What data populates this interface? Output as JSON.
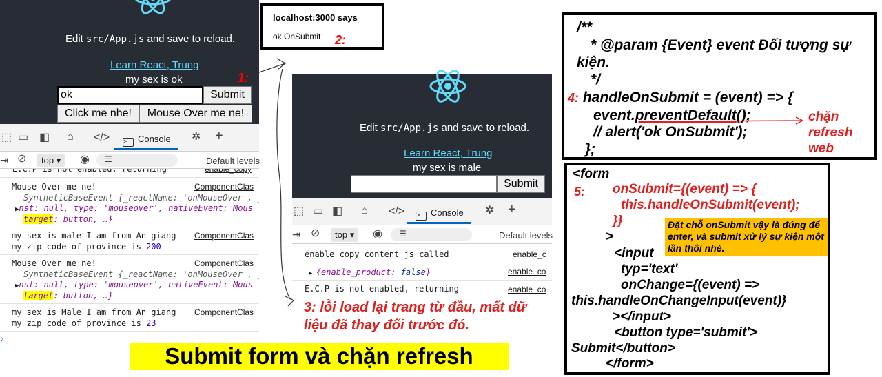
{
  "left_app": {
    "edit_prefix": "Edit ",
    "edit_code": "src/App.js",
    "edit_suffix": " and save to reload.",
    "learn_link": "Learn React, Trung",
    "sex_text": "my sex is ok",
    "input_value": "ok",
    "submit_label": "Submit",
    "click_btn": "Click me nhe!",
    "hover_btn": "Mouse Over me ne!"
  },
  "left_devtools": {
    "console_tab": "Console",
    "context": "top",
    "levels": "Default levels",
    "logs": [
      {
        "text": "E.C.P is not enabled, returning",
        "src": "enable_copy"
      },
      {
        "text": "Mouse Over me ne!",
        "src": "ComponentClas"
      },
      {
        "obj1": "SyntheticBaseEvent {_reactName: 'onMouseOver', _",
        "obj2": "nst: null, type: 'mouseover', nativeEvent: Mous",
        "obj3_hl": "target",
        "obj3_rest": ": button, …}"
      },
      {
        "text": "my sex is  male I am from  An giang",
        "src": "ComponentClas"
      },
      {
        "text_prefix": "my zip code of province is ",
        "num": "200"
      },
      {
        "text": "Mouse Over me ne!",
        "src": "ComponentClas"
      },
      {
        "obj1": "SyntheticBaseEvent {_reactName: 'onMouseOver', _",
        "obj2": "nst: null, type: 'mouseover', nativeEvent: Mous",
        "obj3_hl": "target",
        "obj3_rest": ": button, …}"
      },
      {
        "text": "my sex is  Male I am from  An giang",
        "src": "ComponentClas"
      },
      {
        "text_prefix": "my zip code of province is ",
        "num": "23"
      }
    ]
  },
  "alert": {
    "title": "localhost:3000 says",
    "message": "ok OnSubmit"
  },
  "right_app": {
    "edit_prefix": "Edit ",
    "edit_code": "src/App.js",
    "edit_suffix": " and save to reload.",
    "learn_link": "Learn React, Trung",
    "sex_text": "my sex is male",
    "submit_label": "Submit"
  },
  "right_devtools": {
    "console_tab": "Console",
    "context": "top",
    "levels": "Default levels",
    "log1": "enable copy content js called",
    "log1_src": "enable_c",
    "log2_key": "enable_product",
    "log2_val": "false",
    "log2_src": "enable_co",
    "log3": "E.C.P is not enabled, returning",
    "log3_src": "enable_co"
  },
  "annotations": {
    "n1": "1:",
    "n2": "2:",
    "n3": "3: lỗi load lại trang từ đầu, mất dữ liệu đã thay đổi trước đó.",
    "n4": "4:",
    "n5": "5:",
    "chan_refresh": "chặn refresh web"
  },
  "code_box_1": {
    "l1": "/**",
    "l2": "* @param {Event} event Đối tượng sự",
    "l3": "kiện.",
    "l4": "*/",
    "l5": "handleOnSubmit = (event) => {",
    "l6_a": "event.",
    "l6_b": "preventDefault",
    "l6_c": "();",
    "l7": "// alert('ok OnSubmit');",
    "l8": "};"
  },
  "code_box_2": {
    "l1": "<form",
    "l2": "onSubmit={(event) => {",
    "l3": "this.handleOnSubmit(event);",
    "l4": "}}",
    "l5": ">",
    "l6": "<input",
    "l7": "typ='text'",
    "l8": "onChange={(event) =>",
    "l9": "this.handleOnChangeInput(event)}",
    "l10": "></input>",
    "l11": "<button type='submit'>",
    "l12": "Submit</button>",
    "l13": "</form>",
    "note": "Đặt chỗ onSubmit vậy là đúng để enter, và submit xử lý sự kiện một lần thôi nhé."
  },
  "banner": "Submit form và chặn refresh",
  "colors": {
    "react_bg": "#282c34",
    "react_blue": "#61dafb",
    "accent_red": "#e0201e",
    "note_orange": "#ffc000",
    "banner_yellow": "#ffff00"
  }
}
